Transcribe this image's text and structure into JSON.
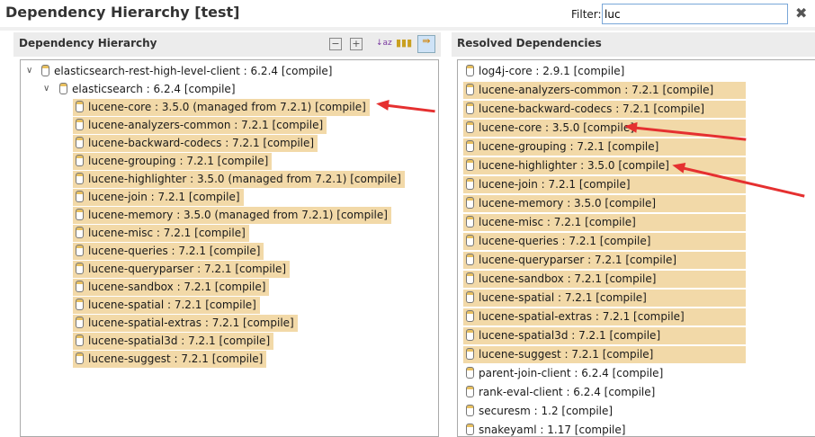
{
  "title": "Dependency Hierarchy [test]",
  "filter": {
    "label": "Filter:",
    "value": "luc"
  },
  "left": {
    "header": "Dependency Hierarchy",
    "root": "elasticsearch-rest-high-level-client : 6.2.4 [compile]",
    "child": "elasticsearch : 6.2.4 [compile]",
    "items": [
      "lucene-core : 3.5.0 (managed from 7.2.1) [compile]",
      "lucene-analyzers-common : 7.2.1 [compile]",
      "lucene-backward-codecs : 7.2.1 [compile]",
      "lucene-grouping : 7.2.1 [compile]",
      "lucene-highlighter : 3.5.0 (managed from 7.2.1) [compile]",
      "lucene-join : 7.2.1 [compile]",
      "lucene-memory : 3.5.0 (managed from 7.2.1) [compile]",
      "lucene-misc : 7.2.1 [compile]",
      "lucene-queries : 7.2.1 [compile]",
      "lucene-queryparser : 7.2.1 [compile]",
      "lucene-sandbox : 7.2.1 [compile]",
      "lucene-spatial : 7.2.1 [compile]",
      "lucene-spatial-extras : 7.2.1 [compile]",
      "lucene-spatial3d : 7.2.1 [compile]",
      "lucene-suggest : 7.2.1 [compile]"
    ]
  },
  "right": {
    "header": "Resolved Dependencies",
    "items": [
      {
        "t": "log4j-core : 2.9.1 [compile]",
        "h": false
      },
      {
        "t": "lucene-analyzers-common : 7.2.1 [compile]",
        "h": true
      },
      {
        "t": "lucene-backward-codecs : 7.2.1 [compile]",
        "h": true
      },
      {
        "t": "lucene-core : 3.5.0 [compile]",
        "h": true
      },
      {
        "t": "lucene-grouping : 7.2.1 [compile]",
        "h": true
      },
      {
        "t": "lucene-highlighter : 3.5.0 [compile]",
        "h": true
      },
      {
        "t": "lucene-join : 7.2.1 [compile]",
        "h": true
      },
      {
        "t": "lucene-memory : 3.5.0 [compile]",
        "h": true
      },
      {
        "t": "lucene-misc : 7.2.1 [compile]",
        "h": true
      },
      {
        "t": "lucene-queries : 7.2.1 [compile]",
        "h": true
      },
      {
        "t": "lucene-queryparser : 7.2.1 [compile]",
        "h": true
      },
      {
        "t": "lucene-sandbox : 7.2.1 [compile]",
        "h": true
      },
      {
        "t": "lucene-spatial : 7.2.1 [compile]",
        "h": true
      },
      {
        "t": "lucene-spatial-extras : 7.2.1 [compile]",
        "h": true
      },
      {
        "t": "lucene-spatial3d : 7.2.1 [compile]",
        "h": true
      },
      {
        "t": "lucene-suggest : 7.2.1 [compile]",
        "h": true
      },
      {
        "t": "parent-join-client : 6.2.4 [compile]",
        "h": false
      },
      {
        "t": "rank-eval-client : 6.2.4 [compile]",
        "h": false
      },
      {
        "t": "securesm : 1.2 [compile]",
        "h": false
      },
      {
        "t": "snakeyaml : 1.17 [compile]",
        "h": false
      }
    ]
  },
  "colors": {
    "highlight": "#f2d9a8",
    "arrow": "#e53030"
  }
}
